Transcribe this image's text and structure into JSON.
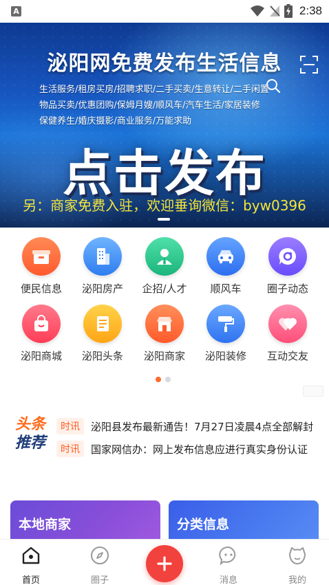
{
  "status_bar": {
    "app_badge": "A",
    "time": "2:38",
    "icons": [
      "wifi-icon",
      "no-signal-icon",
      "battery-charging-icon"
    ]
  },
  "banner": {
    "title": "泌阳网免费发布生活信息",
    "lines": [
      "生活服务/租房买房/招聘求职/二手买卖/生意转让/二手闲置",
      "物品买卖/优惠团购/保姆月嫂/顺风车/汽车生活/家居装修",
      "保健养生/婚庆摄影/商业服务/万能求助"
    ],
    "big_text": "点击发布",
    "footer": "另：商家免费入驻，欢迎垂询微信：byw0396",
    "icons": [
      "scan-icon",
      "search-icon"
    ]
  },
  "categories": [
    {
      "label": "便民信息",
      "icon": "gift-box-icon",
      "color": "#ff6a3d"
    },
    {
      "label": "泌阳房产",
      "icon": "building-icon",
      "color": "#3d8bff"
    },
    {
      "label": "企招/人才",
      "icon": "person-icon",
      "color": "#22c08a"
    },
    {
      "label": "顺风车",
      "icon": "car-icon",
      "color": "#3a7bf0"
    },
    {
      "label": "圈子动态",
      "icon": "chat-circle-icon",
      "color": "#7b5cff"
    },
    {
      "label": "泌阳商城",
      "icon": "shopping-bag-icon",
      "color": "#ff4d64"
    },
    {
      "label": "泌阳头条",
      "icon": "document-icon",
      "color": "#ffb21f"
    },
    {
      "label": "泌阳商家",
      "icon": "shop-icon",
      "color": "#ff6d3a"
    },
    {
      "label": "泌阳装修",
      "icon": "paint-roller-icon",
      "color": "#3d86f5"
    },
    {
      "label": "互动交友",
      "icon": "hearts-icon",
      "color": "#ff5f86"
    }
  ],
  "headline": {
    "logo_top": "头条",
    "logo_bottom": "推荐",
    "items": [
      {
        "tag": "时讯",
        "text": "泌阳县发布最新通告！7月27日凌晨4点全部解封"
      },
      {
        "tag": "时讯",
        "text": "国家网信办：网上发布信息应进行真实身份认证"
      }
    ]
  },
  "cards": [
    {
      "title": "本地商家"
    },
    {
      "title": "分类信息"
    }
  ],
  "tabs": [
    {
      "label": "首页",
      "icon": "home-icon",
      "active": true
    },
    {
      "label": "圈子",
      "icon": "compass-icon",
      "active": false
    },
    {
      "label": "消息",
      "icon": "message-icon",
      "active": false
    },
    {
      "label": "我的",
      "icon": "profile-icon",
      "active": false
    }
  ],
  "fab": {
    "icon": "plus-icon"
  },
  "colors": {
    "accent": "#f2423d",
    "pager_active": "#ff6a2b",
    "banner_footer": "#f4e53a"
  }
}
